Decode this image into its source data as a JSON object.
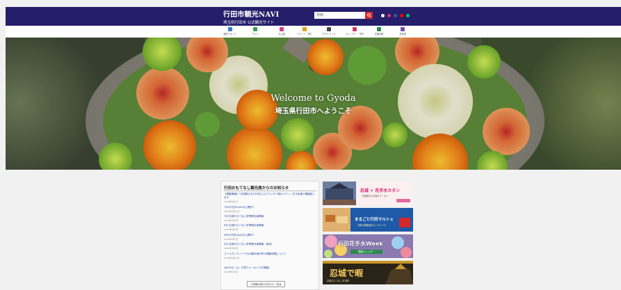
{
  "header": {
    "title": "行田市観光NAVI",
    "subtitle": "埼玉県行田市 公式観光サイト",
    "search_placeholder": "検索...",
    "social": [
      {
        "icon": "x-icon",
        "color": "#ffffff"
      },
      {
        "icon": "instagram-icon",
        "color": "#e1306c"
      },
      {
        "icon": "facebook-icon",
        "color": "#3b5998"
      },
      {
        "icon": "youtube-icon",
        "color": "#ff0000"
      },
      {
        "icon": "line-icon",
        "color": "#06c755"
      }
    ]
  },
  "nav": [
    {
      "label": "観光スポット",
      "icon": "camera-icon",
      "color": "#3a7bd5"
    },
    {
      "label": "グルメ",
      "icon": "fork-knife-icon",
      "color": "#3aa05a"
    },
    {
      "label": "お土産",
      "icon": "gift-icon",
      "color": "#d23b8a"
    },
    {
      "label": "イベント・祭り",
      "icon": "lantern-icon",
      "color": "#e0a020"
    },
    {
      "label": "モデルコース",
      "icon": "walker-icon",
      "color": "#444444"
    },
    {
      "label": "カレンダー・予約",
      "icon": "calendar-icon",
      "color": "#cc3366"
    },
    {
      "label": "交通情報",
      "icon": "train-icon",
      "color": "#2a8a4a"
    },
    {
      "label": "多言語",
      "icon": "chat-icon",
      "color": "#7a4ab0"
    }
  ],
  "hero": {
    "title": "Welcome to Gyoda",
    "subtitle": "埼玉県行田市へようこそ"
  },
  "news": {
    "heading": "行田おもてなし観光局からのお知らせ",
    "items": [
      {
        "title": "【掲載情報】「古墳群のまち行田エスパワンダー展示ツアー」を予定通り開催致します",
        "date": "2024年8月2日"
      },
      {
        "title": "7月の行田Travelを公開中！",
        "date": "2024年7月23日"
      },
      {
        "title": "7月 忍城おもてなし甲冑隊出演情報",
        "date": "2024年7月2日"
      },
      {
        "title": "6月 忍城おもてなし甲冑隊出演情報",
        "date": "2024年6月5日"
      },
      {
        "title": "6月の行田Travelを公開中！",
        "date": "2024年6月3日"
      },
      {
        "title": "5月 忍城おもてなし甲冑隊出演情報（追加）",
        "date": "2024年5月8日"
      },
      {
        "title": "ゴールデンウィーク中の観光案内所の開館時間について",
        "date": "2024年4月25日"
      },
      {
        "title": "4月20日（土）古墳ウォーキングを開催！",
        "date": "2024年4月9日"
      }
    ],
    "more_label": "行田観光局のお知らせ一覧"
  },
  "banners": [
    {
      "name": "banner-sakitama",
      "text_big": "忍城 + 花手水カタン",
      "text_small": "行田観光のお得なクーポン"
    },
    {
      "name": "banner-marche",
      "text_big": "まるごと行田マルシェ",
      "text_small": "行田の物産品をオンラインで"
    },
    {
      "name": "banner-hanatemizu",
      "text_big": "行田花手水Week",
      "text_small": "開催カレンダー"
    },
    {
      "name": "banner-oshijo",
      "text_big": "忍城で暇",
      "text_small": "忍城おもてなし甲冑隊"
    }
  ]
}
